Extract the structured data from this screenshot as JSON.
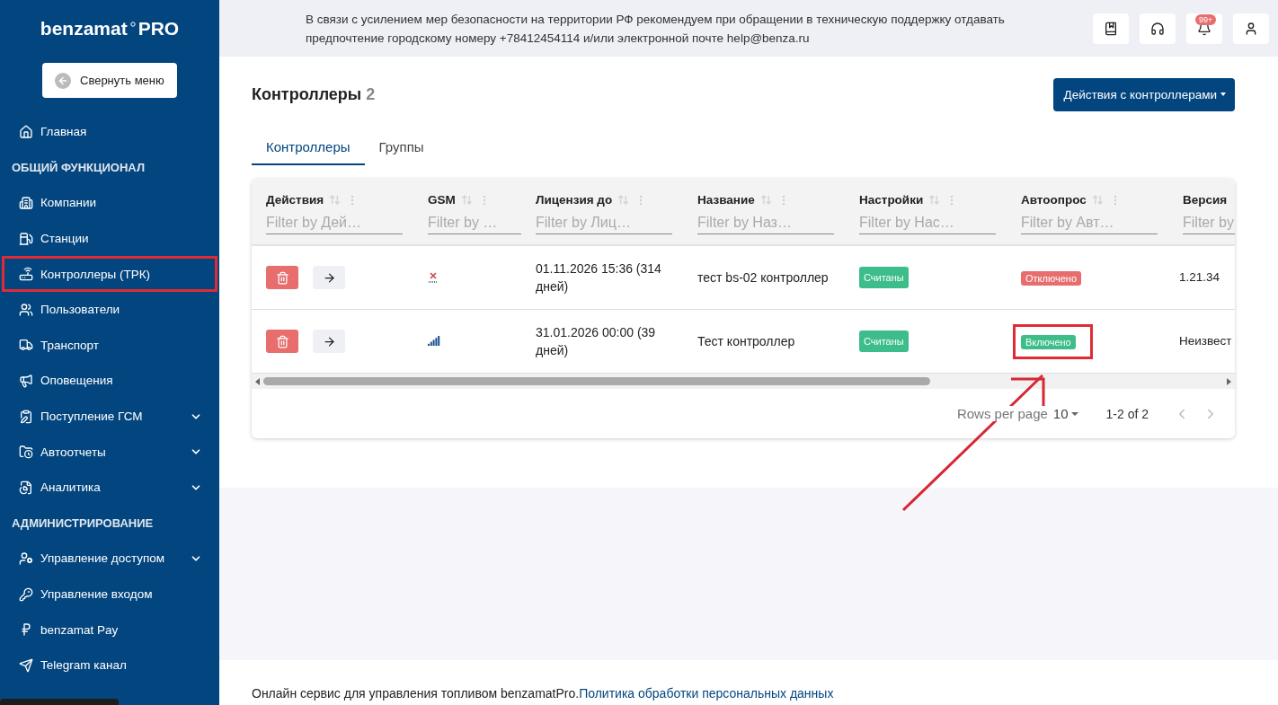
{
  "sidebar": {
    "logo": {
      "name": "benzamat",
      "suffix": "PRO"
    },
    "collapse_button": "Свернуть меню",
    "items": [
      {
        "kind": "item",
        "label": "Главная",
        "expandable": false,
        "highlighted": false
      },
      {
        "kind": "section",
        "label": "ОБЩИЙ ФУНКЦИОНАЛ"
      },
      {
        "kind": "item",
        "label": "Компании",
        "expandable": false,
        "highlighted": false
      },
      {
        "kind": "item",
        "label": "Станции",
        "expandable": false,
        "highlighted": false
      },
      {
        "kind": "item",
        "label": "Контроллеры (ТРК)",
        "expandable": false,
        "highlighted": true
      },
      {
        "kind": "item",
        "label": "Пользователи",
        "expandable": false,
        "highlighted": false
      },
      {
        "kind": "item",
        "label": "Транспорт",
        "expandable": false,
        "highlighted": false
      },
      {
        "kind": "item",
        "label": "Оповещения",
        "expandable": false,
        "highlighted": false
      },
      {
        "kind": "item",
        "label": "Поступление ГСМ",
        "expandable": true,
        "highlighted": false
      },
      {
        "kind": "item",
        "label": "Автоотчеты",
        "expandable": true,
        "highlighted": false
      },
      {
        "kind": "item",
        "label": "Аналитика",
        "expandable": true,
        "highlighted": false
      },
      {
        "kind": "section",
        "label": "АДМИНИСТРИРОВАНИЕ"
      },
      {
        "kind": "item",
        "label": "Управление доступом",
        "expandable": true,
        "highlighted": false
      },
      {
        "kind": "item",
        "label": "Управление входом",
        "expandable": false,
        "highlighted": false
      },
      {
        "kind": "item",
        "label": "benzamat Pay",
        "expandable": false,
        "highlighted": false
      },
      {
        "kind": "item",
        "label": "Telegram канал",
        "expandable": false,
        "highlighted": false
      }
    ]
  },
  "notice": "В связи с усилением мер безопасности на территории РФ рекомендуем при обращении в техническую поддержку отдавать предпочтение городскому номеру +78412454114 и/или электронной почте help@benza.ru",
  "notifications_badge": "99+",
  "page": {
    "title": "Контроллеры",
    "count": "2",
    "actions_button": "Действия с контроллерами"
  },
  "tabs": [
    {
      "label": "Контроллеры",
      "selected": true
    },
    {
      "label": "Группы",
      "selected": false
    }
  ],
  "table": {
    "columns": [
      {
        "label": "Действия",
        "placeholder": "Filter by Дей…"
      },
      {
        "label": "GSM",
        "placeholder": "Filter by …"
      },
      {
        "label": "Лицензия до",
        "placeholder": "Filter by Лиц…"
      },
      {
        "label": "Название",
        "placeholder": "Filter by Наз…"
      },
      {
        "label": "Настройки",
        "placeholder": "Filter by Нас…"
      },
      {
        "label": "Автоопрос",
        "placeholder": "Filter by Авт…"
      },
      {
        "label": "Версия",
        "placeholder": "Filter by"
      }
    ],
    "rows": [
      {
        "gsm": {
          "kind": "none"
        },
        "license": "01.11.2026 15:36 (314 дней)",
        "name": "тест bs-02 контроллер",
        "settings": {
          "text": "Считаны",
          "color": "#3dbd8a"
        },
        "autopoll": {
          "text": "Отключено",
          "color": "#e86e6e",
          "highlighted": false
        },
        "version": "1.21.34"
      },
      {
        "gsm": {
          "kind": "signal"
        },
        "license": "31.01.2026 00:00 (39 дней)",
        "name": "Тест контроллер",
        "settings": {
          "text": "Считаны",
          "color": "#3dbd8a"
        },
        "autopoll": {
          "text": "Включено",
          "color": "#3dbd8a",
          "highlighted": true
        },
        "version": "Неизвест"
      }
    ],
    "pagination": {
      "rows_per_page_label": "Rows per page",
      "rows_per_page": "10",
      "range": "1-2 of 2"
    }
  },
  "footer": {
    "text": "Онлайн сервис для управления топливом benzamatPro.",
    "link": "Политика обработки персональных данных"
  }
}
